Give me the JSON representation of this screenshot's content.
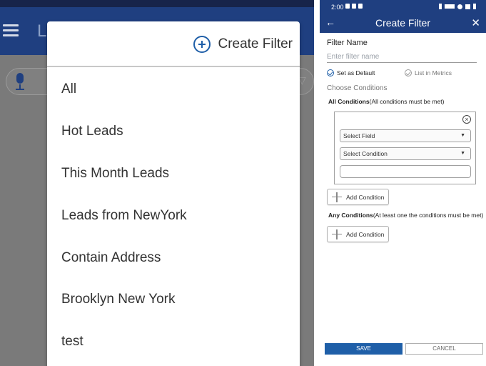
{
  "left": {
    "background_title": "Le",
    "header_action_label": "Create Filter",
    "filters": [
      "All",
      "Hot Leads",
      "This Month Leads",
      "Leads from NewYork",
      "Contain Address",
      "Brooklyn New York",
      "test"
    ]
  },
  "right": {
    "status_time": "2:00",
    "title": "Create Filter",
    "filter_name_label": "Filter Name",
    "filter_name_placeholder": "Enter filter name",
    "set_default_label": "Set as Default",
    "list_in_metrics_label": "List in Metrics",
    "choose_conditions_label": "Choose Conditions",
    "all_conditions_title": "All Conditions",
    "all_conditions_hint": "(All conditions must be met)",
    "select_field_label": "Select Field",
    "select_condition_label": "Select Condition",
    "add_condition_label": "Add Condition",
    "any_conditions_title": "Any Conditions",
    "any_conditions_hint": "(At least one the conditions must be met)",
    "save_label": "SAVE",
    "cancel_label": "CANCEL"
  },
  "colors": {
    "brand_blue": "#1f3f80",
    "accent_blue": "#1f5fa8"
  }
}
